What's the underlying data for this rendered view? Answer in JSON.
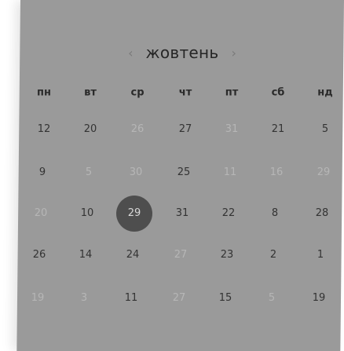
{
  "header": {
    "prev_icon": "‹",
    "month": "жовтень",
    "next_icon": "›"
  },
  "weekdays": [
    "пн",
    "вт",
    "ср",
    "чт",
    "пт",
    "сб",
    "нд"
  ],
  "weeks": [
    [
      {
        "d": "12",
        "m": false
      },
      {
        "d": "20",
        "m": false
      },
      {
        "d": "26",
        "m": true
      },
      {
        "d": "27",
        "m": false
      },
      {
        "d": "31",
        "m": true
      },
      {
        "d": "21",
        "m": false
      },
      {
        "d": "5",
        "m": false
      }
    ],
    [
      {
        "d": "9",
        "m": false
      },
      {
        "d": "5",
        "m": true
      },
      {
        "d": "30",
        "m": true
      },
      {
        "d": "25",
        "m": false
      },
      {
        "d": "11",
        "m": true
      },
      {
        "d": "16",
        "m": true
      },
      {
        "d": "29",
        "m": true
      }
    ],
    [
      {
        "d": "20",
        "m": true
      },
      {
        "d": "10",
        "m": false
      },
      {
        "d": "29",
        "m": false,
        "selected": true
      },
      {
        "d": "31",
        "m": false
      },
      {
        "d": "22",
        "m": false
      },
      {
        "d": "8",
        "m": false
      },
      {
        "d": "28",
        "m": false
      }
    ],
    [
      {
        "d": "26",
        "m": false
      },
      {
        "d": "14",
        "m": false
      },
      {
        "d": "24",
        "m": false
      },
      {
        "d": "27",
        "m": true
      },
      {
        "d": "23",
        "m": false
      },
      {
        "d": "2",
        "m": false
      },
      {
        "d": "1",
        "m": false
      }
    ],
    [
      {
        "d": "19",
        "m": true
      },
      {
        "d": "3",
        "m": true
      },
      {
        "d": "11",
        "m": false
      },
      {
        "d": "27",
        "m": true
      },
      {
        "d": "15",
        "m": false
      },
      {
        "d": "5",
        "m": true
      },
      {
        "d": "19",
        "m": false
      }
    ]
  ]
}
